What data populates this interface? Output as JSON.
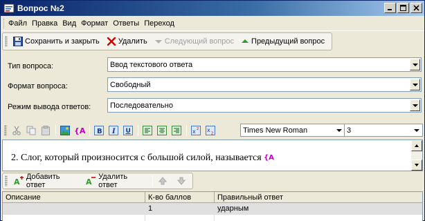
{
  "window": {
    "title": "Вопрос №2"
  },
  "menu": [
    "Файл",
    "Правка",
    "Вид",
    "Формат",
    "Ответы",
    "Переход"
  ],
  "toolbar": {
    "save_close": "Сохранить и закрыть",
    "delete": "Удалить",
    "next_question": "Следующий вопрос",
    "prev_question": "Предыдущий вопрос"
  },
  "form": {
    "question_type_label": "Тип вопроса:",
    "question_type_value": "Ввод текстового ответа",
    "question_format_label": "Формат вопроса:",
    "question_format_value": "Свободный",
    "answer_mode_label": "Режим вывода ответов:",
    "answer_mode_value": "Последовательно"
  },
  "editor_toolbar": {
    "font": "Times New Roman",
    "size": "3"
  },
  "question": {
    "text": "2. Слог, который произносится с большой силой, называется"
  },
  "answers_toolbar": {
    "add": "Добавить ответ",
    "remove": "Удалить ответ"
  },
  "answers_grid": {
    "columns": [
      "Описание",
      "К-во баллов",
      "Правильный ответ"
    ],
    "rows": [
      {
        "description": "",
        "points": "1",
        "answer": "ударным"
      }
    ]
  },
  "colors": {
    "title_start": "#0a246a",
    "title_end": "#a6caf0",
    "delete_icon": "#d40000",
    "add_icon": "#2e9a2e"
  }
}
